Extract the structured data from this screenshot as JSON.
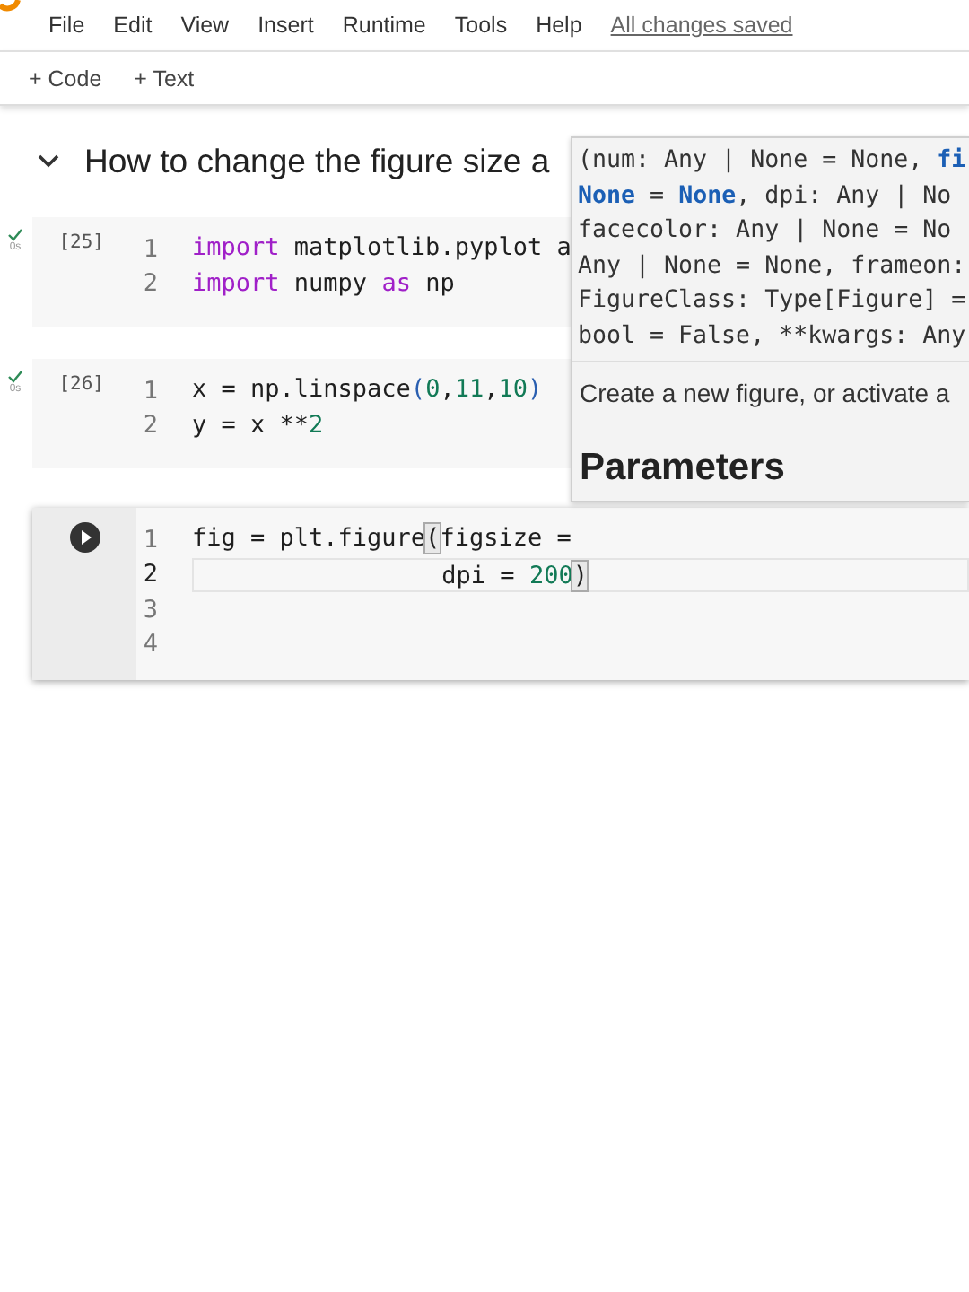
{
  "menu": [
    "File",
    "Edit",
    "View",
    "Insert",
    "Runtime",
    "Tools",
    "Help"
  ],
  "save_status": "All changes saved",
  "toolbar": [
    {
      "symbol": "+",
      "label": "Code"
    },
    {
      "symbol": "+",
      "label": "Text"
    }
  ],
  "section": {
    "title": "How to change the figure size a",
    "expanded": true
  },
  "cells": [
    {
      "kind": "done",
      "count": "[25]",
      "time": "0s",
      "lines": [
        {
          "number": "1",
          "current": false,
          "tokens": [
            {
              "text": "import",
              "kind": "keyword"
            },
            {
              "text": " matplotlib.pyplot a",
              "kind": "plain"
            }
          ]
        },
        {
          "number": "2",
          "current": false,
          "tokens": [
            {
              "text": "import",
              "kind": "keyword"
            },
            {
              "text": " numpy ",
              "kind": "plain"
            },
            {
              "text": "as",
              "kind": "keyword"
            },
            {
              "text": " np",
              "kind": "plain"
            }
          ]
        }
      ]
    },
    {
      "kind": "done",
      "count": "[26]",
      "time": "0s",
      "lines": [
        {
          "number": "1",
          "current": false,
          "tokens": [
            {
              "text": "x = np.linspace",
              "kind": "plain"
            },
            {
              "text": "(",
              "kind": "paren"
            },
            {
              "text": "0",
              "kind": "number"
            },
            {
              "text": ",",
              "kind": "plain"
            },
            {
              "text": "11",
              "kind": "number"
            },
            {
              "text": ",",
              "kind": "plain"
            },
            {
              "text": "10",
              "kind": "number"
            },
            {
              "text": ")",
              "kind": "paren"
            }
          ]
        },
        {
          "number": "2",
          "current": false,
          "tokens": [
            {
              "text": "y = x **",
              "kind": "plain"
            },
            {
              "text": "2",
              "kind": "number"
            }
          ]
        }
      ]
    },
    {
      "kind": "active",
      "lines": [
        {
          "number": "1",
          "current": false,
          "tokens": [
            {
              "text": "fig = plt.figure",
              "kind": "plain"
            },
            {
              "text": "(",
              "kind": "match"
            },
            {
              "text": "figsize =",
              "kind": "plain"
            }
          ]
        },
        {
          "number": "2",
          "current": true,
          "tokens": [
            {
              "text": "                 dpi = ",
              "kind": "plain"
            },
            {
              "text": "200",
              "kind": "number"
            },
            {
              "text": ")",
              "kind": "match"
            }
          ]
        },
        {
          "number": "3",
          "current": false
        },
        {
          "number": "4",
          "current": false
        }
      ]
    }
  ],
  "tooltip": {
    "signature": [
      [
        {
          "text": "(num: Any | None = None, ",
          "kind": "plain"
        },
        {
          "text": "fi",
          "kind": "param"
        }
      ],
      [
        {
          "text": "None",
          "kind": "param"
        },
        {
          "text": " = ",
          "kind": "plain"
        },
        {
          "text": "None",
          "kind": "param"
        },
        {
          "text": ", dpi: Any | No",
          "kind": "plain"
        }
      ],
      [
        {
          "text": "facecolor: Any | None = No",
          "kind": "plain"
        }
      ],
      [
        {
          "text": "Any | None = None, frameon:",
          "kind": "plain"
        }
      ],
      [
        {
          "text": "FigureClass: Type[Figure] =",
          "kind": "plain"
        }
      ],
      [
        {
          "text": "bool = False, **kwargs: Any",
          "kind": "plain"
        }
      ]
    ],
    "description": "Create a new figure, or activate a",
    "heading": "Parameters"
  }
}
